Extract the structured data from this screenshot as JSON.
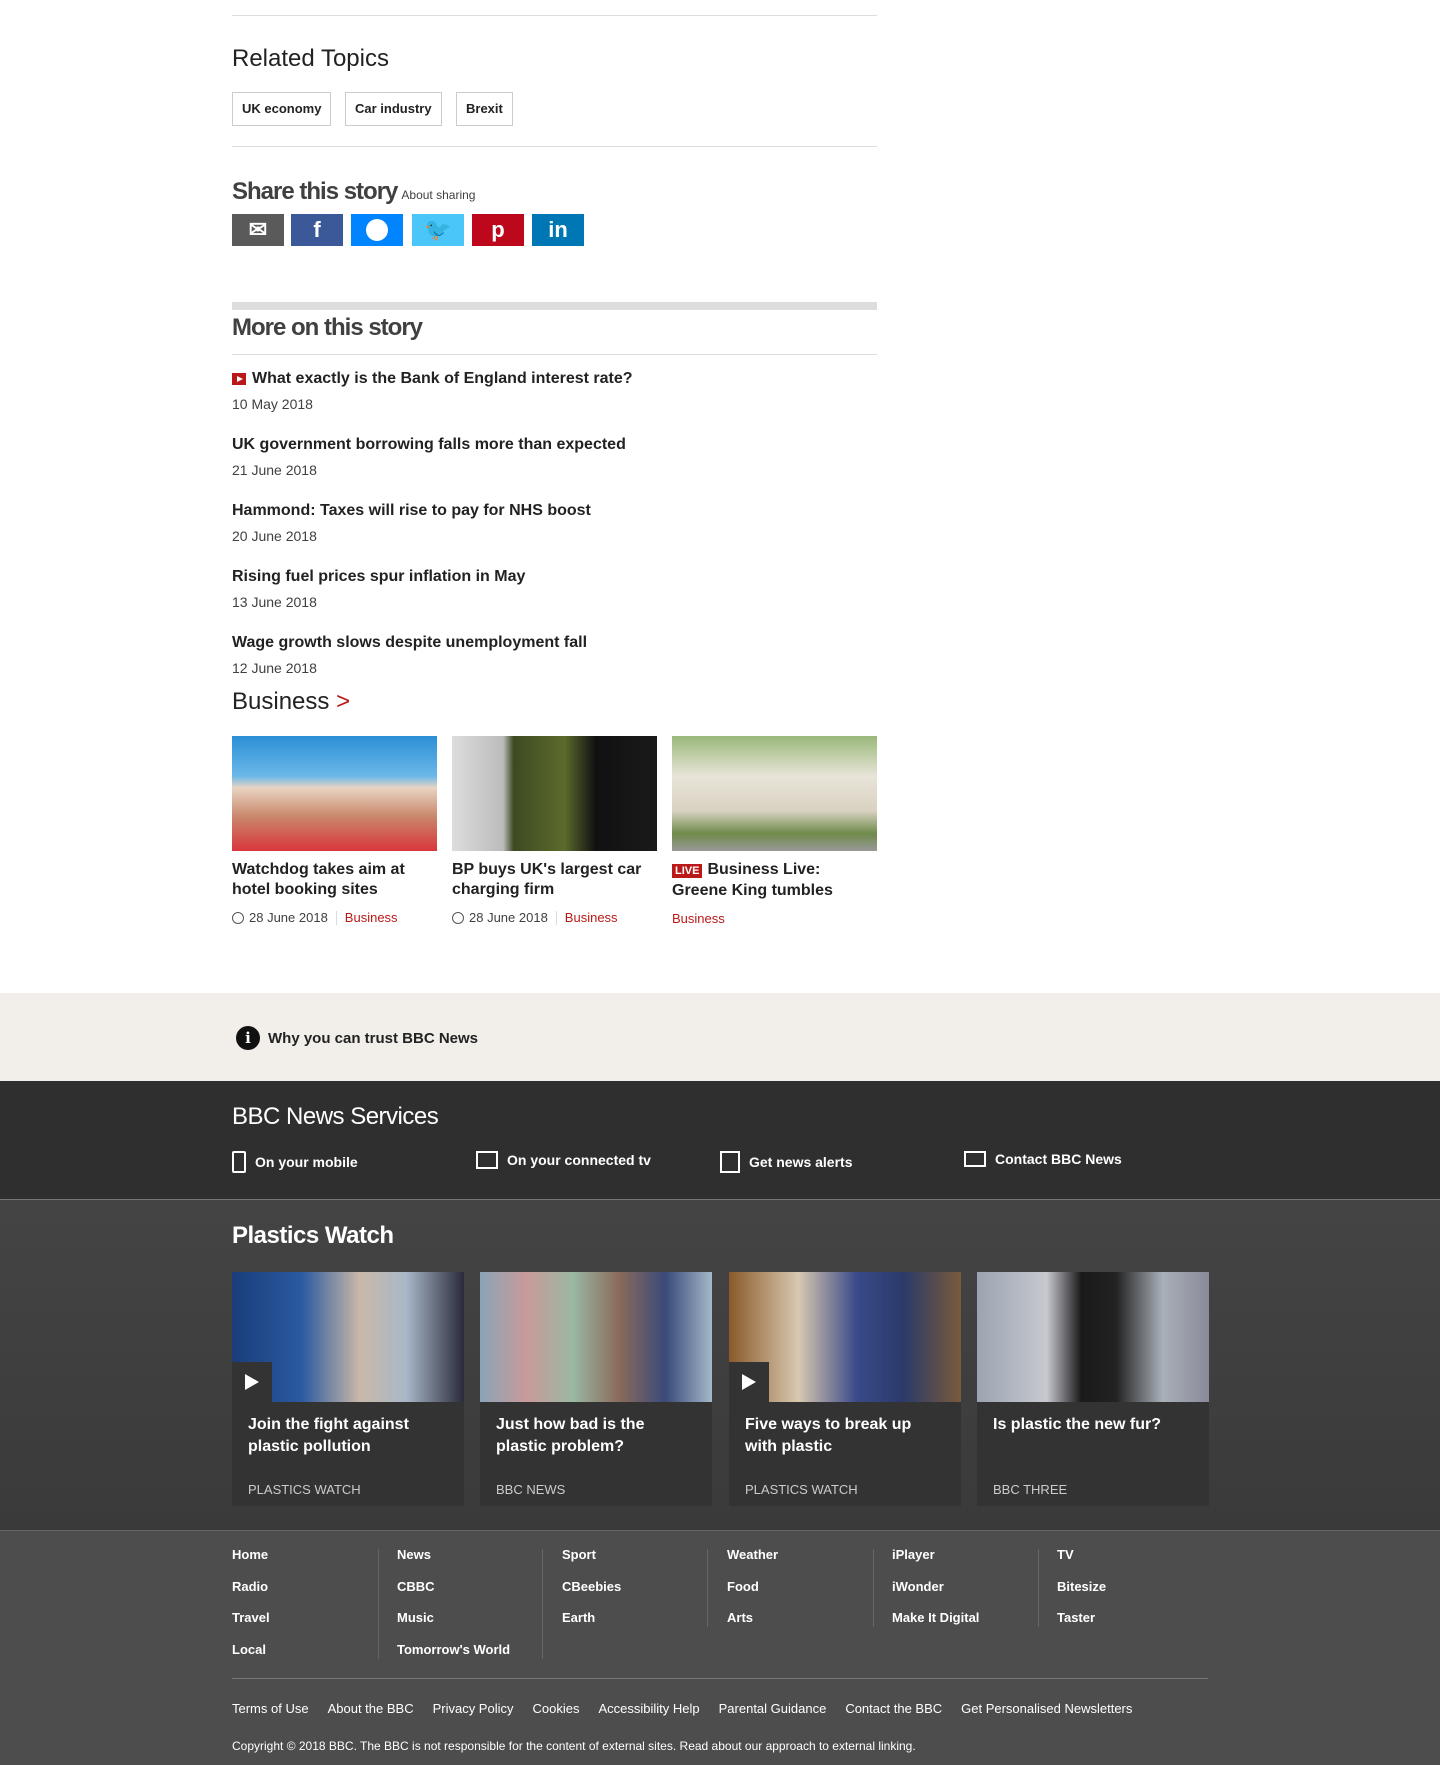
{
  "related": {
    "title": "Related Topics",
    "tags": [
      "UK economy",
      "Car industry",
      "Brexit"
    ]
  },
  "share": {
    "title": "Share this story",
    "about": "About sharing",
    "buttons": [
      {
        "name": "email",
        "color": "#5a5a5a"
      },
      {
        "name": "facebook",
        "color": "#3b5998"
      },
      {
        "name": "messenger",
        "color": "#0084ff"
      },
      {
        "name": "twitter",
        "color": "#4ac6f8"
      },
      {
        "name": "pinterest",
        "color": "#bd081c"
      },
      {
        "name": "linkedin",
        "color": "#0077b5"
      }
    ]
  },
  "more": {
    "title": "More on this story",
    "items": [
      {
        "title": "What exactly is the Bank of England interest rate?",
        "date": "10 May 2018",
        "video": true
      },
      {
        "title": "UK government borrowing falls more than expected",
        "date": "21 June 2018"
      },
      {
        "title": "Hammond: Taxes will rise to pay for NHS boost",
        "date": "20 June 2018"
      },
      {
        "title": "Rising fuel prices spur inflation in May",
        "date": "13 June 2018"
      },
      {
        "title": "Wage growth slows despite unemployment fall",
        "date": "12 June 2018"
      }
    ]
  },
  "business": {
    "title": "Business",
    "chevron": ">",
    "cards": [
      {
        "title": "Watchdog takes aim at hotel booking sites",
        "date": "28 June 2018",
        "section": "Business"
      },
      {
        "title": "BP buys UK's largest car charging firm",
        "date": "28 June 2018",
        "section": "Business"
      },
      {
        "live": "LIVE",
        "title": "Business Live: Greene King tumbles",
        "section": "Business"
      }
    ]
  },
  "trust": {
    "label": "Why you can trust BBC News"
  },
  "services": {
    "title": "BBC News Services",
    "items": [
      "On your mobile",
      "On your connected tv",
      "Get news alerts",
      "Contact BBC News"
    ]
  },
  "plastics": {
    "title": "Plastics Watch",
    "cards": [
      {
        "title": "Join the fight against plastic pollution",
        "source": "PLASTICS WATCH",
        "video": true
      },
      {
        "title": "Just how bad is the plastic problem?",
        "source": "BBC NEWS"
      },
      {
        "title": "Five ways to break up with plastic",
        "source": "PLASTICS WATCH",
        "video": true
      },
      {
        "title": "Is plastic the new fur?",
        "source": "BBC THREE"
      }
    ]
  },
  "footer": {
    "columns": [
      [
        "Home",
        "Radio",
        "Travel",
        "Local"
      ],
      [
        "News",
        "CBBC",
        "Music",
        "Tomorrow's World"
      ],
      [
        "Sport",
        "CBeebies",
        "Earth"
      ],
      [
        "Weather",
        "Food",
        "Arts"
      ],
      [
        "iPlayer",
        "iWonder",
        "Make It Digital"
      ],
      [
        "TV",
        "Bitesize",
        "Taster"
      ]
    ],
    "links": [
      "Terms of Use",
      "About the BBC",
      "Privacy Policy",
      "Cookies",
      "Accessibility Help",
      "Parental Guidance",
      "Contact the BBC",
      "Get Personalised Newsletters"
    ],
    "copyright": "Copyright © 2018 BBC. The BBC is not responsible for the content of external sites. Read about our approach to external linking."
  }
}
